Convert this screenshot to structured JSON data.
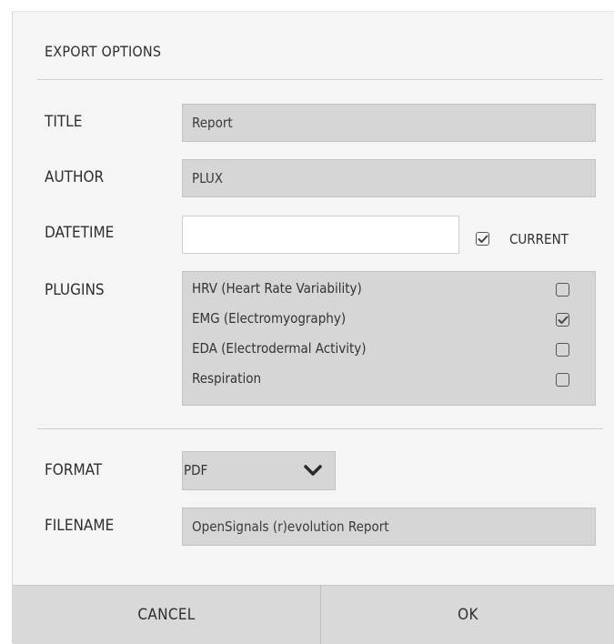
{
  "dialog": {
    "title": "EXPORT OPTIONS",
    "fields": {
      "title": {
        "label": "TITLE",
        "value": "Report"
      },
      "author": {
        "label": "AUTHOR",
        "value": "PLUX"
      },
      "datetime": {
        "label": "DATETIME",
        "value": "",
        "current_label": "CURRENT",
        "current_checked": true
      },
      "plugins": {
        "label": "PLUGINS",
        "items": [
          {
            "name": "HRV (Heart Rate Variability)",
            "checked": false
          },
          {
            "name": "EMG (Electromyography)",
            "checked": true
          },
          {
            "name": "EDA (Electrodermal Activity)",
            "checked": false
          },
          {
            "name": "Respiration",
            "checked": false
          }
        ]
      },
      "format": {
        "label": "FORMAT",
        "value": "PDF"
      },
      "filename": {
        "label": "FILENAME",
        "value": "OpenSignals (r)evolution Report"
      }
    },
    "buttons": {
      "cancel": "CANCEL",
      "ok": "OK"
    }
  },
  "icons": {
    "check": "check-icon",
    "dropdown": "chevron-down-icon"
  }
}
